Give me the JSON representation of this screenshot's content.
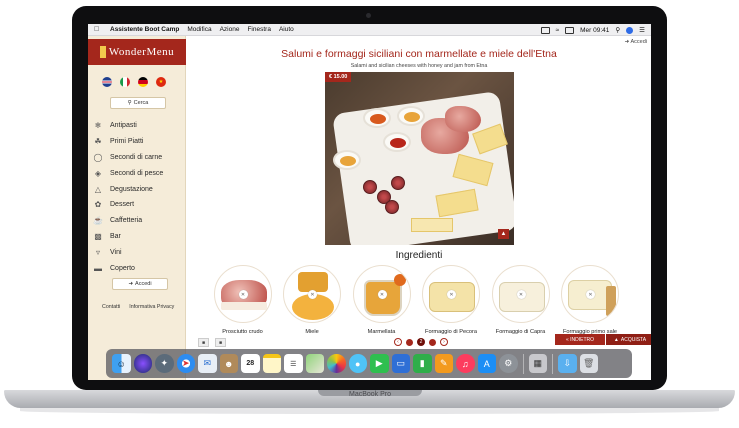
{
  "menubar": {
    "app_name": "Assistente Boot Camp",
    "menus": [
      "Modifica",
      "Azione",
      "Finestra",
      "Aiuto"
    ],
    "clock": "Mer 09:41"
  },
  "sidebar": {
    "logo": "WonderMenu",
    "languages": [
      "english-flag",
      "italian-flag",
      "german-flag",
      "chinese-flag"
    ],
    "search_label": "Cerca",
    "items": [
      {
        "label": "Antipasti",
        "icon": "antipasti-icon"
      },
      {
        "label": "Primi Piatti",
        "icon": "pasta-icon"
      },
      {
        "label": "Secondi di carne",
        "icon": "meat-icon"
      },
      {
        "label": "Secondi di pesce",
        "icon": "fish-icon"
      },
      {
        "label": "Degustazione",
        "icon": "tasting-icon"
      },
      {
        "label": "Dessert",
        "icon": "dessert-icon"
      },
      {
        "label": "Caffetteria",
        "icon": "coffee-icon"
      },
      {
        "label": "Bar",
        "icon": "bar-icon"
      },
      {
        "label": "Vini",
        "icon": "wine-icon"
      },
      {
        "label": "Coperto",
        "icon": "cover-icon"
      }
    ],
    "login_label": "Accedi",
    "footer": {
      "contacts": "Contatti",
      "privacy": "Informativa Privacy"
    }
  },
  "main": {
    "accedi": "Accedi",
    "title": "Salumi e formaggi siciliani con marmellate e miele dell'Etna",
    "subtitle": "Salami and sicilian cheeses with honey and jam from Etna",
    "price": "€ 15.00",
    "ingredients_title": "Ingredienti",
    "ingredients": [
      {
        "name": "Prosciutto crudo"
      },
      {
        "name": "Miele"
      },
      {
        "name": "Marmellata"
      },
      {
        "name": "Formaggio di Pecora"
      },
      {
        "name": "Formaggio di Capra"
      },
      {
        "name": "Formaggio primo sale"
      }
    ],
    "pager_current": "2",
    "back_label": "« INDIETRO",
    "buy_label": "ACQUISTA"
  },
  "laptop": {
    "model": "MacBook Pro"
  },
  "dock": {
    "apps": [
      "finder",
      "siri",
      "launchpad",
      "safari",
      "mail",
      "notes-book",
      "calendar",
      "notes",
      "reminders",
      "maps",
      "photos",
      "messages",
      "facetime",
      "keynote",
      "numbers",
      "pages",
      "music",
      "app-store",
      "system-preferences",
      "boot-camp",
      "downloads",
      "trash"
    ],
    "calendar_day": "28"
  },
  "colors": {
    "accent": "#a4271c",
    "sidebar_bg": "#f5ecd9"
  }
}
